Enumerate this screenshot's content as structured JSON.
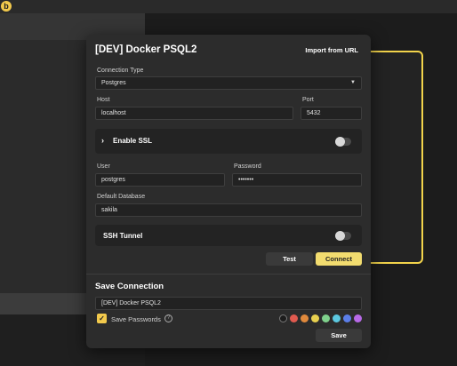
{
  "app": {
    "icon": "app-logo-icon",
    "icon_letter": "b"
  },
  "modal": {
    "title": "[DEV] Docker PSQL2",
    "import_link": "Import from URL",
    "connection_type": {
      "label": "Connection Type",
      "value": "Postgres"
    },
    "host": {
      "label": "Host",
      "value": "localhost"
    },
    "port": {
      "label": "Port",
      "value": "5432"
    },
    "ssl": {
      "label": "Enable SSL",
      "enabled": false
    },
    "user": {
      "label": "User",
      "value": "postgres"
    },
    "password": {
      "label": "Password",
      "value": "•••••••"
    },
    "database": {
      "label": "Default Database",
      "value": "sakila"
    },
    "ssh": {
      "label": "SSH Tunnel",
      "enabled": false
    },
    "buttons": {
      "test": "Test",
      "connect": "Connect",
      "save": "Save"
    },
    "save_section": {
      "title": "Save Connection",
      "name_value": "[DEV] Docker PSQL2",
      "save_passwords_label": "Save Passwords",
      "save_passwords_checked": true,
      "help_icon_glyph": "?",
      "checkmark_glyph": "✓",
      "chevron_glyph": "›",
      "caret_glyph": "▼",
      "colors": [
        "#1c1c1c",
        "#e05a4f",
        "#e0893c",
        "#e8d04f",
        "#7fd18c",
        "#5cc8e0",
        "#5b7ee8",
        "#b86ae8"
      ]
    }
  },
  "accent": "#f2d34b"
}
